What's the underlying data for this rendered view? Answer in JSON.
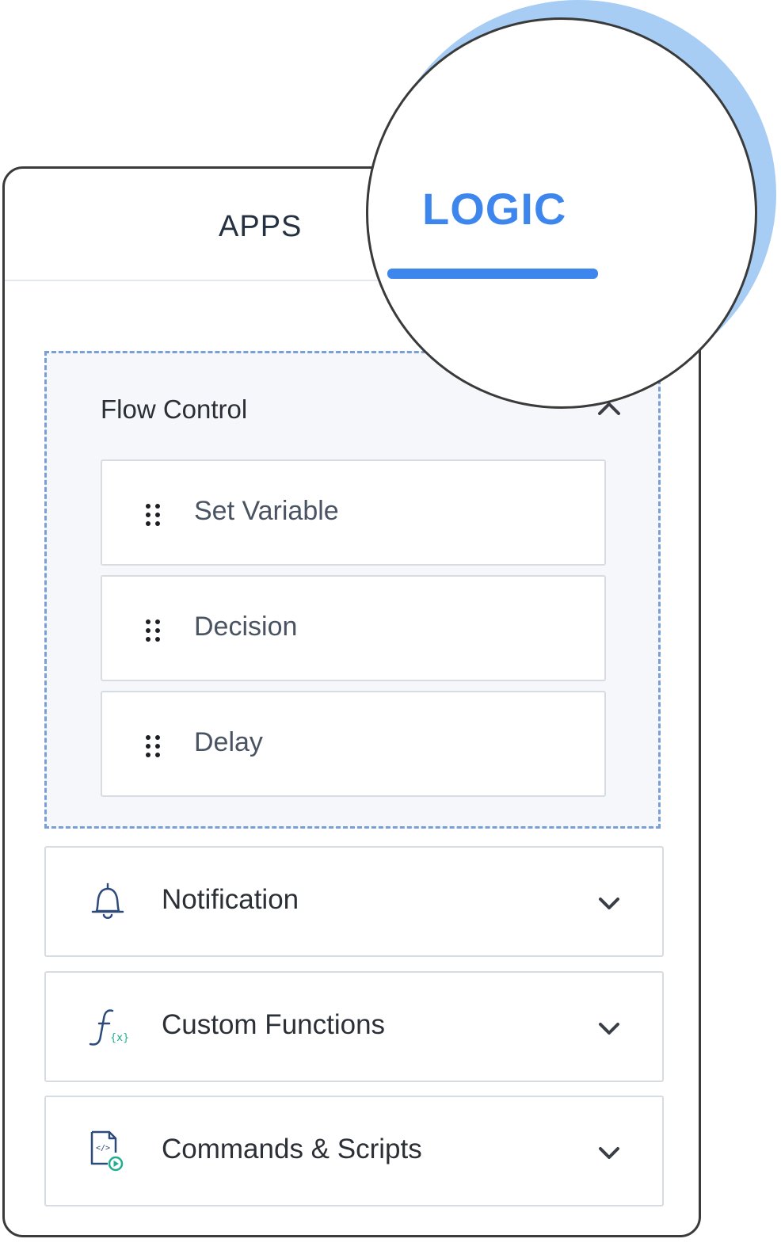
{
  "tabs": {
    "apps_label": "APPS",
    "logic_label": "LOGIC",
    "active": "LOGIC"
  },
  "flow_control": {
    "title": "Flow Control",
    "expanded": true,
    "items": [
      {
        "label": "Set Variable",
        "icon": "drag-handle-icon"
      },
      {
        "label": "Decision",
        "icon": "drag-handle-icon"
      },
      {
        "label": "Delay",
        "icon": "drag-handle-icon"
      }
    ]
  },
  "categories": [
    {
      "label": "Notification",
      "icon": "bell-icon",
      "expanded": false
    },
    {
      "label": "Custom Functions",
      "icon": "function-icon",
      "expanded": false
    },
    {
      "label": "Commands & Scripts",
      "icon": "script-file-icon",
      "expanded": false
    }
  ],
  "colors": {
    "accent": "#3d86ee",
    "magnifier_shadow": "#a7cdf4",
    "group_border": "#7a9ed6",
    "group_background": "#f5f7fa",
    "text_dark": "#2b2f36",
    "text_muted": "#4a5361",
    "icon_teal": "#1fae8f",
    "icon_navy": "#2c4a7a"
  }
}
